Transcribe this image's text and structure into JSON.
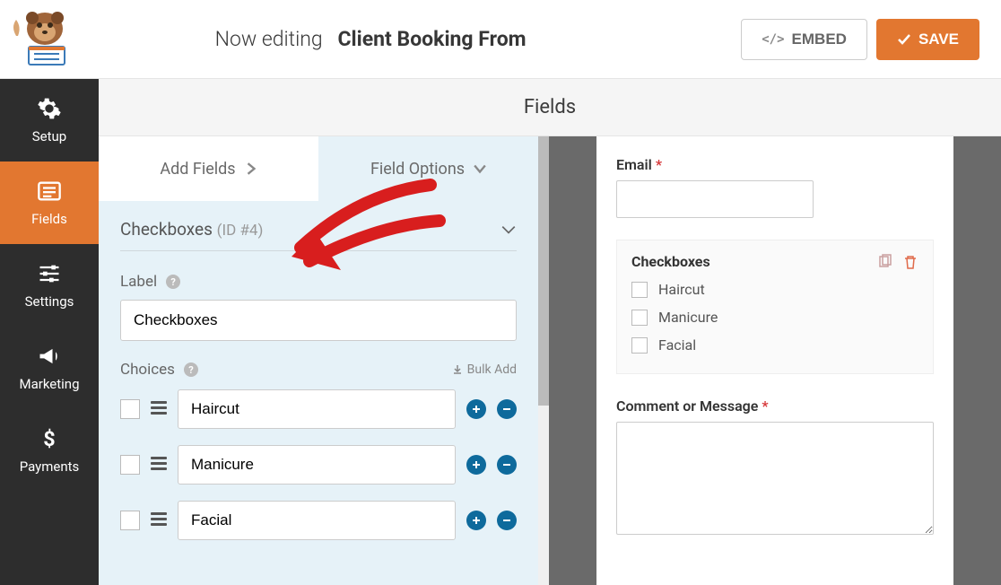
{
  "header": {
    "editing_prefix": "Now editing",
    "form_name": "Client Booking From",
    "embed_label": "EMBED",
    "save_label": "SAVE"
  },
  "sidebar": {
    "items": [
      {
        "label": "Setup",
        "icon": "gear-icon"
      },
      {
        "label": "Fields",
        "icon": "list-icon"
      },
      {
        "label": "Settings",
        "icon": "sliders-icon"
      },
      {
        "label": "Marketing",
        "icon": "bullhorn-icon"
      },
      {
        "label": "Payments",
        "icon": "dollar-icon"
      }
    ]
  },
  "breadcrumb": "Fields",
  "tabs": {
    "add": "Add Fields",
    "options": "Field Options"
  },
  "field": {
    "type": "Checkboxes",
    "id_text": "(ID #4)",
    "label_heading": "Label",
    "label_value": "Checkboxes",
    "choices_heading": "Choices",
    "bulk_add": "Bulk Add",
    "choices": [
      "Haircut",
      "Manicure",
      "Facial"
    ]
  },
  "preview": {
    "email_label": "Email",
    "checkboxes_label": "Checkboxes",
    "items": [
      "Haircut",
      "Manicure",
      "Facial"
    ],
    "comment_label": "Comment or Message"
  },
  "colors": {
    "accent": "#e27730",
    "dark": "#2d2d2d",
    "blue": "#0e6a9c"
  }
}
